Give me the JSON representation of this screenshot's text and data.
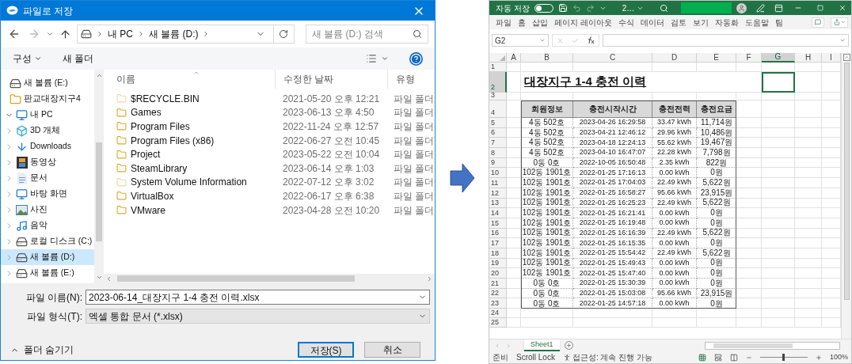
{
  "dialog": {
    "title": "파일로 저장",
    "address": [
      "내 PC",
      "새 볼륨 (D:)"
    ],
    "search": {
      "placeholder": "새 볼륨 (D:) 검색"
    },
    "toolbar": {
      "organize": "구성",
      "new_folder": "새 폴더"
    },
    "nav": [
      {
        "label": "새 볼륨 (E:)",
        "kind": "drive",
        "selected": false
      },
      {
        "label": "판교대장지구4",
        "kind": "folder",
        "selected": false
      },
      {
        "label": "내 PC",
        "kind": "pc",
        "selected": false,
        "expanded": true,
        "children": [
          {
            "label": "3D 개체",
            "kind": "objects",
            "selected": false,
            "expanded": false
          },
          {
            "label": "Downloads",
            "kind": "downloads",
            "selected": false,
            "expanded": false
          },
          {
            "label": "동영상",
            "kind": "videos",
            "selected": false,
            "expanded": false
          },
          {
            "label": "문서",
            "kind": "documents",
            "selected": false,
            "expanded": false
          },
          {
            "label": "바탕 화면",
            "kind": "desktop",
            "selected": false,
            "expanded": false
          },
          {
            "label": "사진",
            "kind": "pictures",
            "selected": false,
            "expanded": false
          },
          {
            "label": "음악",
            "kind": "music",
            "selected": false,
            "expanded": false
          },
          {
            "label": "로컬 디스크 (C:)",
            "kind": "system_drive",
            "selected": false,
            "expanded": false
          },
          {
            "label": "새 볼륨 (D:)",
            "kind": "drive",
            "selected": true,
            "expanded": false
          },
          {
            "label": "새 볼륨 (E:)",
            "kind": "drive",
            "selected": false,
            "expanded": false
          }
        ]
      }
    ],
    "columns": [
      "이름",
      "수정한 날짜",
      "유형"
    ],
    "files": [
      {
        "name": "$RECYCLE.BIN",
        "modified": "2021-05-20 오후 12:21",
        "type": "파일 폴더",
        "hidden": true
      },
      {
        "name": "Games",
        "modified": "2023-06-13 오후 4:50",
        "type": "파일 폴더",
        "hidden": false
      },
      {
        "name": "Program Files",
        "modified": "2022-11-24 오후 12:57",
        "type": "파일 폴더",
        "hidden": false
      },
      {
        "name": "Program Files (x86)",
        "modified": "2022-06-27 오전 10:45",
        "type": "파일 폴더",
        "hidden": false
      },
      {
        "name": "Project",
        "modified": "2023-05-22 오전 10:04",
        "type": "파일 폴더",
        "hidden": false
      },
      {
        "name": "SteamLibrary",
        "modified": "2023-06-14 오후 1:03",
        "type": "파일 폴더",
        "hidden": false
      },
      {
        "name": "System Volume Information",
        "modified": "2022-07-12 오후 3:02",
        "type": "파일 폴더",
        "hidden": true
      },
      {
        "name": "VirtualBox",
        "modified": "2022-06-17 오후 6:38",
        "type": "파일 폴더",
        "hidden": false
      },
      {
        "name": "VMware",
        "modified": "2023-04-28 오전 10:20",
        "type": "파일 폴더",
        "hidden": false
      }
    ],
    "file_name": {
      "label": "파일 이름(N):",
      "value": "2023-06-14_대장지구 1-4 충전 이력.xlsx"
    },
    "file_type": {
      "label": "파일 형식(T):",
      "value": "엑셀 통합 문서 (*.xlsx)"
    },
    "hide_folders": "폴더 숨기기",
    "buttons": [
      {
        "label": "저장(S)",
        "default": true
      },
      {
        "label": "취소",
        "default": false
      }
    ]
  },
  "excel": {
    "autosave": {
      "label": "자동 저장",
      "on": false
    },
    "file_name": "2…",
    "menu": [
      "파일",
      "홈",
      "삽입",
      "페이지 레이아웃",
      "수식",
      "데이터",
      "검토",
      "보기",
      "자동화",
      "도움말",
      "팀"
    ],
    "name_box": "G2",
    "columns": [
      {
        "label": "A",
        "selected": false
      },
      {
        "label": "B",
        "selected": false
      },
      {
        "label": "C",
        "selected": false
      },
      {
        "label": "D",
        "selected": false
      },
      {
        "label": "E",
        "selected": false
      },
      {
        "label": "F",
        "selected": false
      },
      {
        "label": "G",
        "selected": true
      },
      {
        "label": "H",
        "selected": false
      },
      {
        "label": "I",
        "selected": false
      }
    ],
    "rows": [
      {
        "label": "1",
        "selected": false
      },
      {
        "label": "2",
        "selected": true
      },
      {
        "label": "3",
        "selected": false
      },
      {
        "label": "4",
        "selected": false
      },
      {
        "label": "5",
        "selected": false
      },
      {
        "label": "6",
        "selected": false
      },
      {
        "label": "7",
        "selected": false
      },
      {
        "label": "8",
        "selected": false
      },
      {
        "label": "9",
        "selected": false
      },
      {
        "label": "10",
        "selected": false
      },
      {
        "label": "11",
        "selected": false
      },
      {
        "label": "12",
        "selected": false
      },
      {
        "label": "13",
        "selected": false
      },
      {
        "label": "14",
        "selected": false
      },
      {
        "label": "15",
        "selected": false
      },
      {
        "label": "16",
        "selected": false
      },
      {
        "label": "17",
        "selected": false
      },
      {
        "label": "18",
        "selected": false
      },
      {
        "label": "19",
        "selected": false
      },
      {
        "label": "20",
        "selected": false
      },
      {
        "label": "21",
        "selected": false
      },
      {
        "label": "22",
        "selected": false
      },
      {
        "label": "23",
        "selected": false
      },
      {
        "label": "24",
        "selected": false
      },
      {
        "label": "25",
        "selected": false
      }
    ],
    "title": "대장지구 1-4 충전 이력",
    "table": {
      "columns": [
        "회원정보",
        "충전시작시간",
        "충전전력",
        "충전요금"
      ],
      "rows": [
        [
          "4동 502호",
          "2023-04-26 16:29:58",
          "33.47 kWh",
          "11,714원"
        ],
        [
          "4동 502호",
          "2023-04-21 12:46:12",
          "29.96 kWh",
          "10,486원"
        ],
        [
          "4동 502호",
          "2023-04-18 12:24:13",
          "55.62 kWh",
          "19,467원"
        ],
        [
          "4동 502호",
          "2023-04-10 16:47:07",
          "22.28 kWh",
          "7,798원"
        ],
        [
          "0동 0호",
          "2022-10-05 16:50:48",
          "2.35 kWh",
          "822원"
        ],
        [
          "102동 1901호",
          "2022-01-25 17:16:13",
          "0.00 kWh",
          "0원"
        ],
        [
          "102동 1901호",
          "2022-01-25 17:04:03",
          "22.49 kWh",
          "5,622원"
        ],
        [
          "102동 1901호",
          "2022-01-25 16:58:27",
          "95.66 kWh",
          "23,915원"
        ],
        [
          "102동 1901호",
          "2022-01-25 16:25:23",
          "22.49 kWh",
          "5,622원"
        ],
        [
          "102동 1901호",
          "2022-01-25 16:21:41",
          "0.00 kWh",
          "0원"
        ],
        [
          "102동 1901호",
          "2022-01-25 16:19:48",
          "0.00 kWh",
          "0원"
        ],
        [
          "102동 1901호",
          "2022-01-25 16:16:39",
          "22.49 kWh",
          "5,622원"
        ],
        [
          "102동 1901호",
          "2022-01-25 16:15:35",
          "0.00 kWh",
          "0원"
        ],
        [
          "102동 1901호",
          "2022-01-25 15:54:42",
          "22.49 kWh",
          "5,622원"
        ],
        [
          "102동 1901호",
          "2022-01-25 15:49:43",
          "0.00 kWh",
          "0원"
        ],
        [
          "102동 1901호",
          "2022-01-25 15:47:40",
          "0.00 kWh",
          "0원"
        ],
        [
          "0동 0호",
          "2022-01-25 15:30:39",
          "0.00 kWh",
          "0원"
        ],
        [
          "0동 0호",
          "2022-01-25 15:03:08",
          "95.66 kWh",
          "23,915원"
        ],
        [
          "0동 0호",
          "2022-01-25 14:57:18",
          "0.00 kWh",
          "0원"
        ]
      ]
    },
    "sheets": [
      {
        "label": "Sheet1",
        "selected": true
      }
    ],
    "status": [
      "준비",
      "Scroll Lock"
    ],
    "accessibility": "접근성: 계속 진행 가능",
    "zoom": {
      "level": 0.5,
      "reading": "100%"
    }
  }
}
